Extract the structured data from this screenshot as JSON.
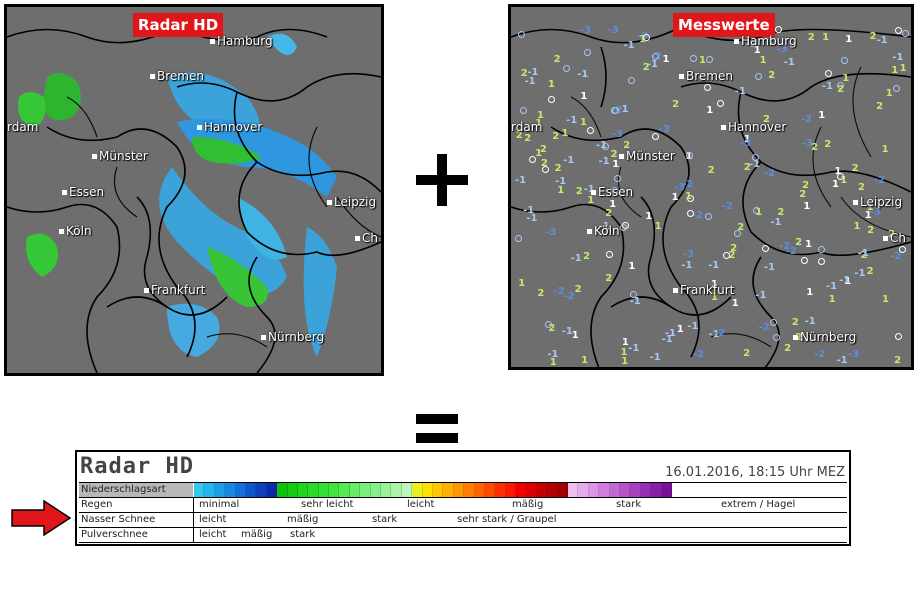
{
  "radar_map": {
    "title": "Radar HD",
    "cities": [
      {
        "key": "hamburg",
        "name": "Hamburg"
      },
      {
        "key": "bremen",
        "name": "Bremen"
      },
      {
        "key": "hannover",
        "name": "Hannover"
      },
      {
        "key": "dam",
        "name": "rdam"
      },
      {
        "key": "muenster",
        "name": "Münster"
      },
      {
        "key": "essen",
        "name": "Essen"
      },
      {
        "key": "leipzig",
        "name": "Leipzig"
      },
      {
        "key": "koeln",
        "name": "Köln"
      },
      {
        "key": "ch",
        "name": "Ch"
      },
      {
        "key": "frankfurt",
        "name": "Frankfurt"
      },
      {
        "key": "nuernberg",
        "name": "Nürnberg"
      }
    ]
  },
  "measure_map": {
    "title": "Messwerte",
    "cities": [
      {
        "key": "hamburg",
        "name": "Hamburg"
      },
      {
        "key": "bremen",
        "name": "Bremen"
      },
      {
        "key": "hannover",
        "name": "Hannover"
      },
      {
        "key": "dam",
        "name": "rdam"
      },
      {
        "key": "muenster",
        "name": "Münster"
      },
      {
        "key": "essen",
        "name": "Essen"
      },
      {
        "key": "leipzig",
        "name": "Leipzig"
      },
      {
        "key": "koeln",
        "name": "Köln"
      },
      {
        "key": "ch",
        "name": "Ch"
      },
      {
        "key": "frankfurt",
        "name": "Frankfurt"
      },
      {
        "key": "nuernberg",
        "name": "Nürnberg"
      }
    ],
    "value_colors": {
      "positive": "#c6e86a",
      "zero": "#ffffff",
      "negative_light": "#a8c8f0",
      "negative_dark": "#5c8ede"
    }
  },
  "legend": {
    "title": "Radar HD",
    "datetime": "16.01.2016, 18:15 Uhr MEZ",
    "header_label": "Niederschlagsart",
    "rows": {
      "regen": {
        "label": "Regen",
        "levels": [
          "minimal",
          "sehr leicht",
          "leicht",
          "mäßig",
          "stark",
          "extrem / Hagel"
        ]
      },
      "nasser_schnee": {
        "label": "Nasser Schnee",
        "levels": [
          "leicht",
          "mäßig",
          "stark",
          "sehr stark / Graupel"
        ]
      },
      "pulverschnee": {
        "label": "Pulverschnee",
        "levels": [
          "leicht",
          "mäßig",
          "stark"
        ]
      }
    },
    "scale_colors": [
      "#33c8ee",
      "#22b6ec",
      "#1a9ee8",
      "#1688e2",
      "#126fd8",
      "#0f56cc",
      "#0d3ebc",
      "#0d28a8",
      "#0bc20b",
      "#13cc13",
      "#1fd31f",
      "#2ad92a",
      "#36df36",
      "#44e444",
      "#55e955",
      "#66ee66",
      "#78f078",
      "#88f088",
      "#99f299",
      "#aaf4aa",
      "#bbf6bb",
      "#eaf020",
      "#ffe000",
      "#ffc800",
      "#ffb000",
      "#ff9800",
      "#ff7e00",
      "#ff6400",
      "#ff4a00",
      "#ff3000",
      "#ff1800",
      "#f00000",
      "#dc0000",
      "#c80000",
      "#b40000",
      "#a00000",
      "#f0c0f0",
      "#e8aaee",
      "#dc94e6",
      "#d07edc",
      "#c268d2",
      "#b454c8",
      "#a640be",
      "#982eb4",
      "#8a1ea8",
      "#7c0e9c"
    ]
  }
}
